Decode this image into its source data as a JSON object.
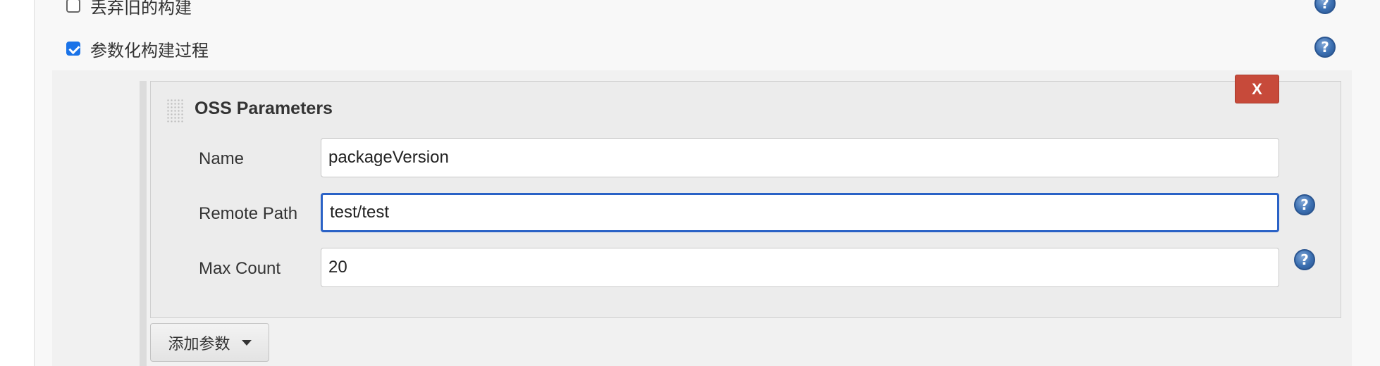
{
  "options": {
    "discard_old_builds": {
      "label": "丢弃旧的构建",
      "checked": false
    },
    "parameterized_build": {
      "label": "参数化构建过程",
      "checked": true
    }
  },
  "parameter": {
    "title": "OSS Parameters",
    "delete_label": "X",
    "fields": {
      "name": {
        "label": "Name",
        "value": "packageVersion"
      },
      "remote_path": {
        "label": "Remote Path",
        "value": "test/test"
      },
      "max_count": {
        "label": "Max Count",
        "value": "20"
      }
    }
  },
  "add_parameter": {
    "label": "添加参数"
  },
  "help_icon_glyph": "?",
  "colors": {
    "delete_button": "#c74a3a",
    "focus_border": "#2a62c6",
    "checkbox_checked": "#1a73e8",
    "help_icon": "#3b6fb1"
  }
}
